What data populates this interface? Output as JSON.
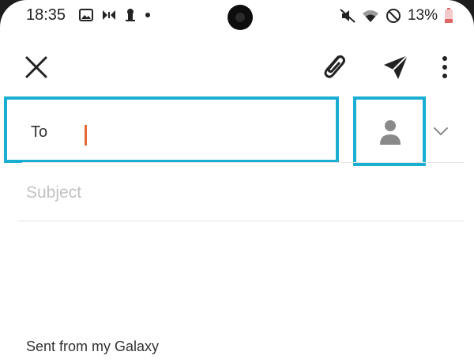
{
  "status_bar": {
    "time": "18:35",
    "battery": "13%",
    "left_icons": [
      "image-icon",
      "nfc-icon",
      "keyhole-icon",
      "dot-icon"
    ],
    "right_icons": [
      "mute-icon",
      "wifi-icon",
      "do-not-disturb-icon",
      "battery-icon"
    ]
  },
  "app_bar": {
    "icons": [
      "close-icon",
      "paperclip-icon",
      "send-icon",
      "more-vert-icon"
    ]
  },
  "compose": {
    "to_label": "To",
    "to_value": "",
    "subject_placeholder": "Subject",
    "subject_value": "",
    "signature": "Sent from my Galaxy"
  },
  "colors": {
    "highlight": "#1aaed3",
    "caret": "#e36a33",
    "icon": "#222222",
    "person_icon": "#8a8a8a"
  }
}
